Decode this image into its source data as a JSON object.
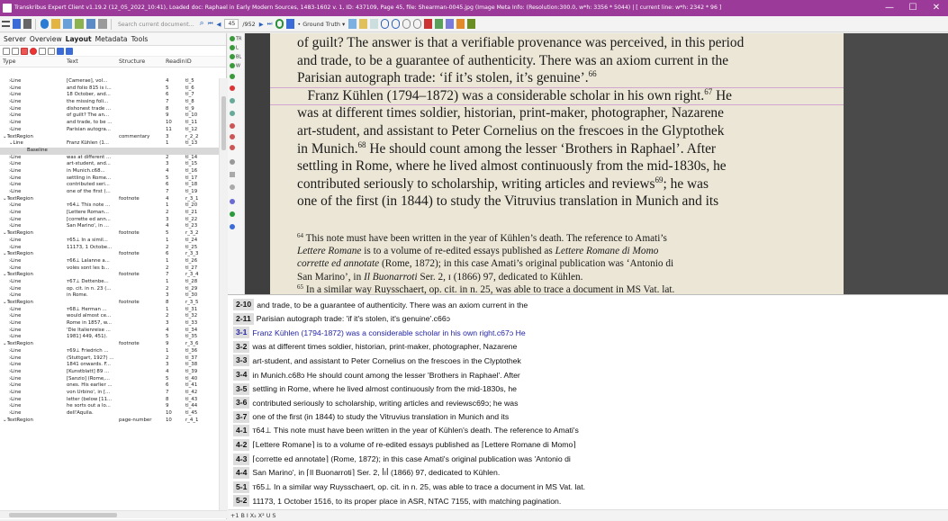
{
  "titlebar": {
    "text": "Transkribus Expert Client v1.19.2 (12_05_2022_10:41), Loaded doc: Raphael in Early Modern Sources, 1483-1602 v. 1, ID: 437109, Page 45, file: Shearman-0045.jpg (Image Meta Info: (Resolution:300.0, w*h: 3356 * 5044) | [ current line: w*h: 2342 * 96 ]"
  },
  "toolbar": {
    "search_placeholder": "Search current document...",
    "page_current": "45",
    "page_total": "/952",
    "ground_truth_label": "Ground Truth"
  },
  "left_panel": {
    "tabs": [
      "Server",
      "Overview",
      "Layout",
      "Metadata",
      "Tools"
    ],
    "active_tab": "Layout",
    "columns": [
      "Type",
      "Text",
      "Structure",
      "Readin...",
      "ID"
    ],
    "rows": [
      {
        "type": "Line",
        "text": "[Camerae], vol...",
        "structure": "",
        "reading": "4",
        "id": "tl_5",
        "indent": 1
      },
      {
        "type": "Line",
        "text": "and folio 815 is i...",
        "structure": "",
        "reading": "5",
        "id": "tl_6",
        "indent": 1
      },
      {
        "type": "Line",
        "text": "18 October, and...",
        "structure": "",
        "reading": "6",
        "id": "tl_7",
        "indent": 1
      },
      {
        "type": "Line",
        "text": "the missing foli...",
        "structure": "",
        "reading": "7",
        "id": "tl_8",
        "indent": 1
      },
      {
        "type": "Line",
        "text": "dishonest trade ...",
        "structure": "",
        "reading": "8",
        "id": "tl_9",
        "indent": 1
      },
      {
        "type": "Line",
        "text": "of guilt? The an...",
        "structure": "",
        "reading": "9",
        "id": "tl_10",
        "indent": 1
      },
      {
        "type": "Line",
        "text": "and trade, to be ...",
        "structure": "",
        "reading": "10",
        "id": "tl_11",
        "indent": 1
      },
      {
        "type": "Line",
        "text": "Parisian autogra...",
        "structure": "",
        "reading": "11",
        "id": "tl_12",
        "indent": 1
      },
      {
        "type": "TextRegion",
        "text": "",
        "structure": "commentary",
        "reading": "3",
        "id": "r_2_2",
        "indent": 0
      },
      {
        "type": "Line",
        "text": "Franz Kühlen (1...",
        "structure": "",
        "reading": "1",
        "id": "tl_13",
        "indent": 1,
        "expanded": true
      },
      {
        "type": "Baseline",
        "text": "",
        "structure": "",
        "reading": "",
        "id": "",
        "indent": 2,
        "selected": true
      },
      {
        "type": "Line",
        "text": "was at different ...",
        "structure": "",
        "reading": "2",
        "id": "tl_14",
        "indent": 1
      },
      {
        "type": "Line",
        "text": "art-student, and...",
        "structure": "",
        "reading": "3",
        "id": "tl_15",
        "indent": 1
      },
      {
        "type": "Line",
        "text": "in Munich.c68...",
        "structure": "",
        "reading": "4",
        "id": "tl_16",
        "indent": 1
      },
      {
        "type": "Line",
        "text": "settling in Rome...",
        "structure": "",
        "reading": "5",
        "id": "tl_17",
        "indent": 1
      },
      {
        "type": "Line",
        "text": "contributed seri...",
        "structure": "",
        "reading": "6",
        "id": "tl_18",
        "indent": 1
      },
      {
        "type": "Line",
        "text": "one of the first (...",
        "structure": "",
        "reading": "7",
        "id": "tl_19",
        "indent": 1
      },
      {
        "type": "TextRegion",
        "text": "",
        "structure": "footnote",
        "reading": "4",
        "id": "r_3_1",
        "indent": 0
      },
      {
        "type": "Line",
        "text": "т64⊥ This note ...",
        "structure": "",
        "reading": "1",
        "id": "tl_20",
        "indent": 1
      },
      {
        "type": "Line",
        "text": "[Lettere Roman...",
        "structure": "",
        "reading": "2",
        "id": "tl_21",
        "indent": 1
      },
      {
        "type": "Line",
        "text": "[corrette ed ann...",
        "structure": "",
        "reading": "3",
        "id": "tl_22",
        "indent": 1
      },
      {
        "type": "Line",
        "text": "San Marino', in ...",
        "structure": "",
        "reading": "4",
        "id": "tl_23",
        "indent": 1
      },
      {
        "type": "TextRegion",
        "text": "",
        "structure": "footnote",
        "reading": "5",
        "id": "r_3_2",
        "indent": 0
      },
      {
        "type": "Line",
        "text": "т65⊥ In a simil...",
        "structure": "",
        "reading": "1",
        "id": "tl_24",
        "indent": 1
      },
      {
        "type": "Line",
        "text": "11173, 1 Octobe...",
        "structure": "",
        "reading": "2",
        "id": "tl_25",
        "indent": 1
      },
      {
        "type": "TextRegion",
        "text": "",
        "structure": "footnote",
        "reading": "6",
        "id": "r_3_3",
        "indent": 0
      },
      {
        "type": "Line",
        "text": "т66⊥ Lalanne a...",
        "structure": "",
        "reading": "1",
        "id": "tl_26",
        "indent": 1
      },
      {
        "type": "Line",
        "text": "volés sont les b...",
        "structure": "",
        "reading": "2",
        "id": "tl_27",
        "indent": 1
      },
      {
        "type": "TextRegion",
        "text": "",
        "structure": "footnote",
        "reading": "7",
        "id": "r_3_4",
        "indent": 0
      },
      {
        "type": "Line",
        "text": "т67⊥ Dettenbe...",
        "structure": "",
        "reading": "1",
        "id": "tl_28",
        "indent": 1
      },
      {
        "type": "Line",
        "text": "op. cit. in n. 23 (...",
        "structure": "",
        "reading": "2",
        "id": "tl_29",
        "indent": 1
      },
      {
        "type": "Line",
        "text": "in Rome.",
        "structure": "",
        "reading": "3",
        "id": "tl_30",
        "indent": 1
      },
      {
        "type": "TextRegion",
        "text": "",
        "structure": "footnote",
        "reading": "8",
        "id": "r_3_5",
        "indent": 0
      },
      {
        "type": "Line",
        "text": "т68⊥ Herman ...",
        "structure": "",
        "reading": "1",
        "id": "tl_31",
        "indent": 1
      },
      {
        "type": "Line",
        "text": "would almost ce...",
        "structure": "",
        "reading": "2",
        "id": "tl_32",
        "indent": 1
      },
      {
        "type": "Line",
        "text": "Rome in 1857, w...",
        "structure": "",
        "reading": "3",
        "id": "tl_33",
        "indent": 1
      },
      {
        "type": "Line",
        "text": "'Die Italienreise ...",
        "structure": "",
        "reading": "4",
        "id": "tl_34",
        "indent": 1
      },
      {
        "type": "Line",
        "text": "1981] 449, 451).",
        "structure": "",
        "reading": "5",
        "id": "tl_35",
        "indent": 1
      },
      {
        "type": "TextRegion",
        "text": "",
        "structure": "footnote",
        "reading": "9",
        "id": "r_3_6",
        "indent": 0
      },
      {
        "type": "Line",
        "text": "т69⊥ Friedrich ...",
        "structure": "",
        "reading": "1",
        "id": "tl_36",
        "indent": 1
      },
      {
        "type": "Line",
        "text": "(Stuttgart, 1927) ...",
        "structure": "",
        "reading": "2",
        "id": "tl_37",
        "indent": 1
      },
      {
        "type": "Line",
        "text": "1841 onwards. F...",
        "structure": "",
        "reading": "3",
        "id": "tl_38",
        "indent": 1
      },
      {
        "type": "Line",
        "text": "[Kunstblatt] 89 ...",
        "structure": "",
        "reading": "4",
        "id": "tl_39",
        "indent": 1
      },
      {
        "type": "Line",
        "text": "[Sanzio] (Rome,...",
        "structure": "",
        "reading": "5",
        "id": "tl_40",
        "indent": 1
      },
      {
        "type": "Line",
        "text": "ones. His earlier ...",
        "structure": "",
        "reading": "6",
        "id": "tl_41",
        "indent": 1
      },
      {
        "type": "Line",
        "text": "von Urbino', in [...",
        "structure": "",
        "reading": "7",
        "id": "tl_42",
        "indent": 1
      },
      {
        "type": "Line",
        "text": "letter (below [11...",
        "structure": "",
        "reading": "8",
        "id": "tl_43",
        "indent": 1
      },
      {
        "type": "Line",
        "text": "he sorts out a lo...",
        "structure": "",
        "reading": "9",
        "id": "tl_44",
        "indent": 1
      },
      {
        "type": "Line",
        "text": "dell'Aquila.",
        "structure": "",
        "reading": "10",
        "id": "tl_45",
        "indent": 1
      },
      {
        "type": "TextRegion",
        "text": "",
        "structure": "page-number",
        "reading": "10",
        "id": "r_4_1",
        "indent": 0
      }
    ]
  },
  "side_tools": [
    "TR",
    "L",
    "BL",
    "W"
  ],
  "image": {
    "main_lines": [
      {
        "html": "of guilt? The answer is that a verifiable provenance was perceived, in this period"
      },
      {
        "html": "and trade, to be a guarantee of authenticity. There was an axiom current in the"
      },
      {
        "html": "Parisian autograph trade: ‘if it’s stolen, it’s genuine’.<sup>66</sup>"
      },
      {
        "html": "&nbsp;&nbsp;&nbsp;Franz Kühlen (1794–1872) was a considerable scholar in his own right.<sup>67</sup> He"
      },
      {
        "html": "was at different times soldier, historian, print-maker, photographer, Nazarene"
      },
      {
        "html": "art-student, and assistant to Peter Cornelius on the frescoes in the Glyptothek"
      },
      {
        "html": "in Munich.<sup>68</sup> He should count among the lesser ‘Brothers in Raphael’. After"
      },
      {
        "html": "settling in Rome, where he lived almost continuously from the mid-1830s, he"
      },
      {
        "html": "contributed seriously to scholarship, writing articles and reviews<sup>69</sup>; he was"
      },
      {
        "html": "one of the first (in 1844) to study the Vitruvius translation in Munich and its"
      }
    ],
    "foot_lines": [
      "<sup>64</sup> This note must have been written in the year of Kühlen’s death. The reference to Amati’s",
      "<span class='it'>Lettere Romane</span> is to a volume of re-edited essays published as <span class='it'>Lettere Romane di Momo</span>",
      "<span class='it'>corrette ed annotate</span> (Rome, 1872); in this case Amati’s original publication was ‘Antonio di",
      "San Marino’, in <span class='it'>Il Buonarroti</span> Ser. 2, ɪ (1866) 97, dedicated to Kühlen.",
      "<sup>65</sup> In a similar way Ruysschaert, op. cit. in n. 25, was able to trace a document in MS Vat. lat."
    ]
  },
  "transcription": {
    "lines": [
      {
        "num": "2-10",
        "text": "and trade, to be a guarantee of authenticity. There was an axiom current in the"
      },
      {
        "num": "2-11",
        "text": "Parisian autograph trade: 'if it's stolen, it's genuine'.c66ɔ"
      },
      {
        "num": "3-1",
        "text": "Franz Kühlen (1794-1872) was a considerable scholar in his own right.c67ɔ He",
        "current": true
      },
      {
        "num": "3-2",
        "text": "was at different times soldier, historian, print-maker, photographer, Nazarene"
      },
      {
        "num": "3-3",
        "text": "art-student, and assistant to Peter Cornelius on the frescoes in the Clyptothek"
      },
      {
        "num": "3-4",
        "text": "in Munich.c68ɔ He should count among the lesser 'Brothers in Raphael'. After"
      },
      {
        "num": "3-5",
        "text": "settling in Rome, where he lived almost continuously from the mid-1830s, he"
      },
      {
        "num": "3-6",
        "text": "contributed seriously to scholarship, writing articles and reviewsc69ɔ; he was"
      },
      {
        "num": "3-7",
        "text": "one of the first (in 1844) to study the Vitruvius translation in Munich and its"
      },
      {
        "num": "4-1",
        "text": "т64⊥ This note must have been written in the year of Kühlen's death. The reference to Amati's"
      },
      {
        "num": "4-2",
        "text": "⌈Lettere Romane⌉ is to a volume of re-edited essays published as ⌈Lettere Romane di Momo⌉"
      },
      {
        "num": "4-3",
        "text": "⌈corrette ed annotate⌉ (Rome, 1872); in this case Amati's original publication was 'Antonio di"
      },
      {
        "num": "4-4",
        "text": "San Marino', in ⌈Il Buonarroti⌉ Ser. 2, ꟾıꟾ (1866) 97, dedicated to Kühlen."
      },
      {
        "num": "5-1",
        "text": "т65⊥ In a similar way Ruysschaert, op. cit. in n. 25, was able to trace a document in MS Vat. lat."
      },
      {
        "num": "5-2",
        "text": "11173, 1 October 1516, to its proper place in ASR, NTAC 7155, with matching pagination."
      }
    ],
    "editbar_text": "+1   B  I  X₂ X²  U  S"
  }
}
